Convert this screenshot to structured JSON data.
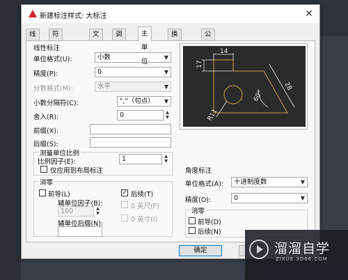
{
  "dialog": {
    "title": "新建标注样式: 大标注",
    "close_glyph": "✕"
  },
  "tabs": [
    "线",
    "符号和箭头",
    "文字",
    "调整",
    "主单位",
    "换算单位",
    "公差"
  ],
  "linear": {
    "group_title": "线性标注",
    "unit_format_label": "单位格式(U):",
    "unit_format_value": "小数",
    "precision_label": "精度(P):",
    "precision_value": "0",
    "fraction_format_label": "分数格式(M):",
    "fraction_format_value": "水平",
    "decimal_sep_label": "小数分隔符(C):",
    "decimal_sep_value": "\",\"（句点）",
    "round_off_label": "舍入(R):",
    "round_off_value": "0",
    "prefix_label": "前缀(X):",
    "prefix_value": "",
    "suffix_label": "后缀(S):",
    "suffix_value": ""
  },
  "scale": {
    "group_title": "测量单位比例",
    "factor_label": "比例因子(E):",
    "factor_value": "1",
    "layout_only_label": "仅应用到布局标注"
  },
  "zero_suppress": {
    "group_title": "消零",
    "leading_label": "前导(L)",
    "trailing_label": "后续(T)",
    "sub_unit_factor_label": "辅单位因子(B):",
    "sub_unit_factor_value": "100",
    "zero_feet_label": "0 英尺(F)",
    "zero_inches_label": "0 英寸(I)",
    "sub_unit_suffix_label": "辅单位后缀(N):",
    "sub_unit_suffix_value": ""
  },
  "angular": {
    "group_title": "角度标注",
    "unit_format_label": "单位格式(A):",
    "unit_format_value": "十进制度数",
    "precision_label": "精度(O):",
    "precision_value": "0",
    "zero_title": "消零",
    "leading_label": "前导(D)",
    "trailing_label": "后续(N)"
  },
  "preview": {
    "dim_14": "14",
    "dim_17": "17",
    "dim_28": "28",
    "dim_60": "60°",
    "dim_r11": "R11"
  },
  "buttons": {
    "ok": "确定",
    "cancel_partial": "取"
  },
  "watermark": {
    "title": "溜溜自学",
    "url": "ZIXUE.3D66.COM"
  },
  "colors": {
    "preview_bg": "#2b2b2b",
    "preview_geometry": "#c8a24a",
    "preview_dims": "#e8e8e8",
    "app_icon": "#d3262c"
  }
}
